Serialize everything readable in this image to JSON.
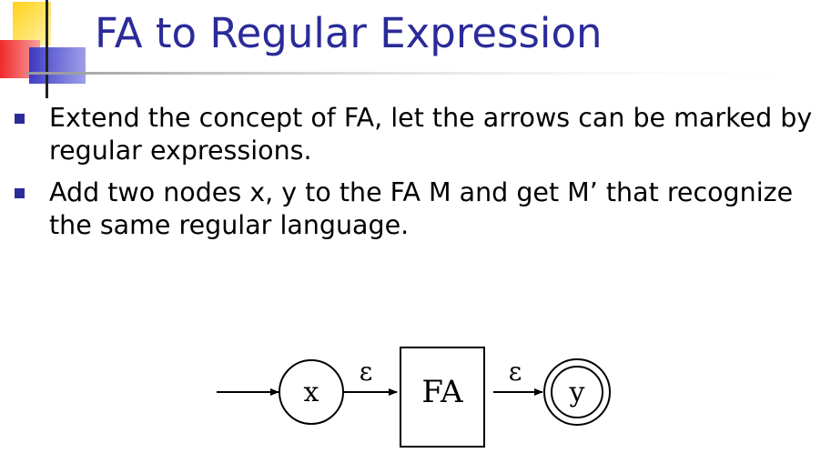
{
  "title": "FA to Regular Expression",
  "bullets": [
    "Extend the concept of FA, let the arrows can be marked by regular expressions.",
    "Add two nodes x, y to the FA M and get M’ that recognize the same regular language."
  ],
  "diagram": {
    "start_state": "x",
    "fa_box_label": "FA",
    "accept_state": "y",
    "edge_in_label": "ε",
    "edge_out_label": "ε"
  },
  "colors": {
    "title": "#2b2b9a",
    "bullet": "#2b2b9a",
    "decor_yellow": "#ffd21a",
    "decor_red": "#f02a2a",
    "decor_blue": "#3434c4"
  }
}
